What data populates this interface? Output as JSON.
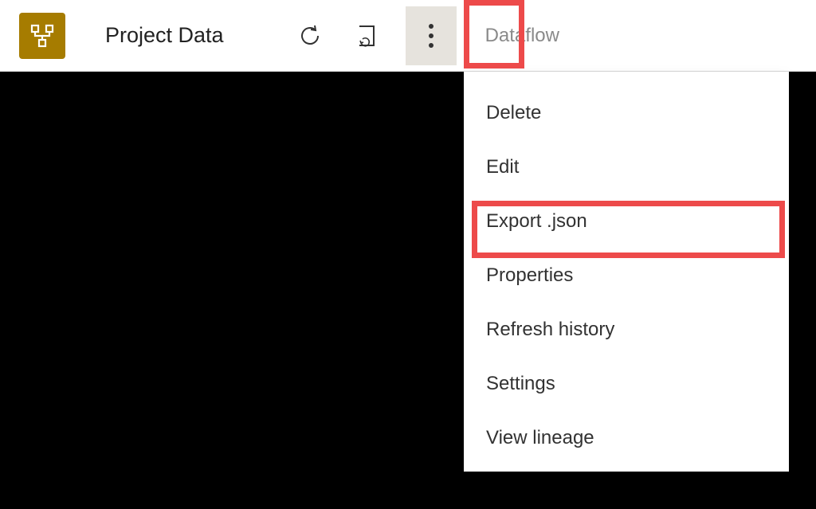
{
  "header": {
    "title": "Project Data",
    "item_type": "Dataflow"
  },
  "menu": {
    "items": [
      {
        "label": "Delete"
      },
      {
        "label": "Edit"
      },
      {
        "label": "Export .json"
      },
      {
        "label": "Properties"
      },
      {
        "label": "Refresh history"
      },
      {
        "label": "Settings"
      },
      {
        "label": "View lineage"
      }
    ]
  },
  "colors": {
    "highlight": "#ed4a4a",
    "icon_bg": "#a67c00"
  }
}
